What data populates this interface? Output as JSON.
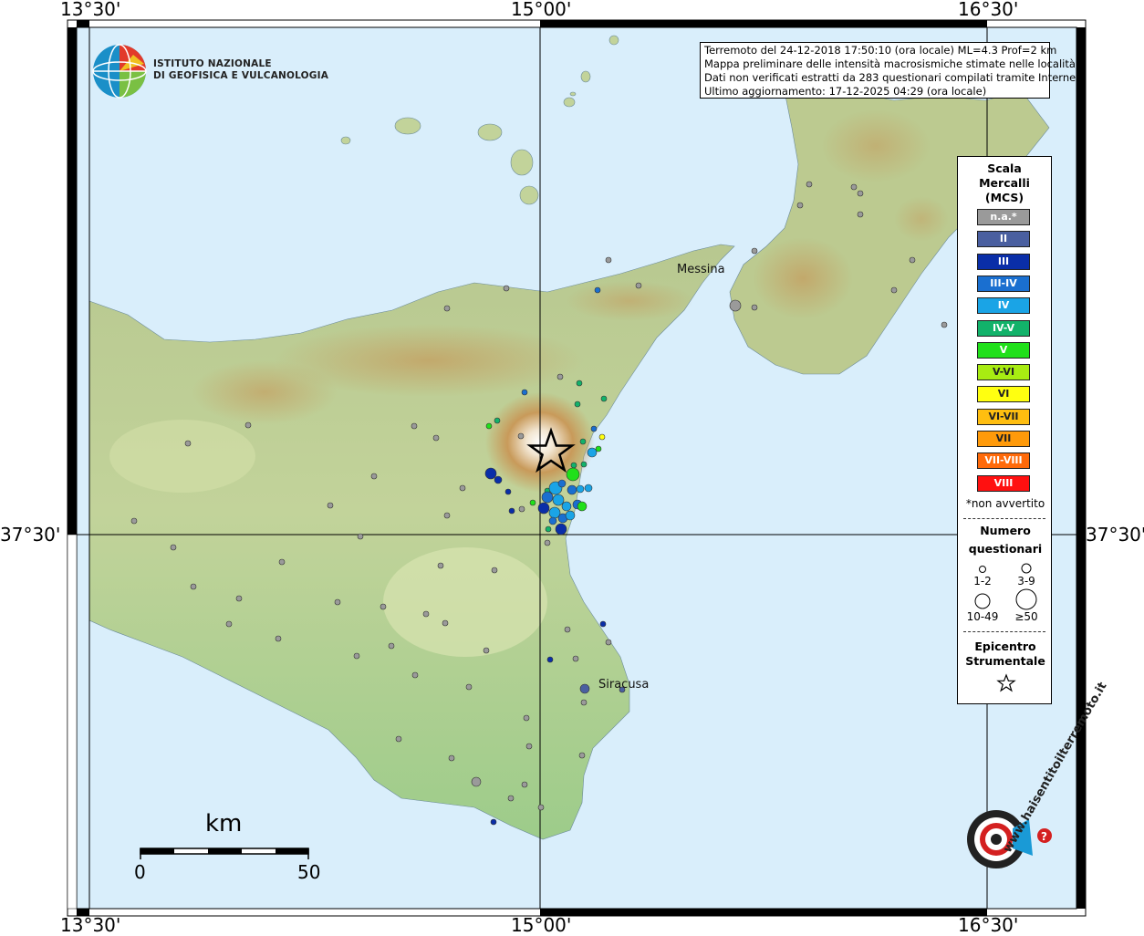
{
  "header": {
    "institute_line1": "ISTITUTO NAZIONALE",
    "institute_line2": "DI GEOFISICA E VULCANOLOGIA"
  },
  "info": {
    "line1": "Terremoto del 24-12-2018 17:50:10 (ora locale) ML=4.3 Prof=2 km",
    "line2": "Mappa preliminare delle intensità macrosismiche stimate nelle località",
    "line3": "Dati non verificati estratti da 283 questionari compilati tramite Internet.",
    "line4": "Ultimo aggiornamento: 17-12-2025 04:29 (ora locale)"
  },
  "coords": {
    "lon1": "13°30'",
    "lon2": "15°00'",
    "lon3": "16°30'",
    "lat1": "37°30'"
  },
  "places": {
    "messina": "Messina",
    "siracusa": "Siracusa"
  },
  "scale": {
    "title": "km",
    "min": "0",
    "max": "50"
  },
  "legend": {
    "title1": "Scala",
    "title2": "Mercalli",
    "title3": "(MCS)",
    "classes": [
      {
        "label": "n.a.*",
        "color": "#9a9a9a"
      },
      {
        "label": "II",
        "color": "#4a5fa0"
      },
      {
        "label": "III",
        "color": "#0a2ea8"
      },
      {
        "label": "III-IV",
        "color": "#1a6fd0"
      },
      {
        "label": "IV",
        "color": "#1aa4e6"
      },
      {
        "label": "IV-V",
        "color": "#12b26a"
      },
      {
        "label": "V",
        "color": "#20e01a"
      },
      {
        "label": "V-VI",
        "color": "#a8ec12"
      },
      {
        "label": "VI",
        "color": "#ffff10"
      },
      {
        "label": "VI-VII",
        "color": "#ffbe10"
      },
      {
        "label": "VII",
        "color": "#ff9a0a"
      },
      {
        "label": "VII-VIII",
        "color": "#ff6a0a"
      },
      {
        "label": "VIII",
        "color": "#ff1010"
      }
    ],
    "footnote": "*non avvertito",
    "count_title1": "Numero",
    "count_title2": "questionari",
    "sizes": [
      "1-2",
      "3-9",
      "10-49",
      "≥50"
    ],
    "epicenter1": "Epicentro",
    "epicenter2": "Strumentale"
  },
  "watermark": "www.haisentitoilterremoto.it"
}
